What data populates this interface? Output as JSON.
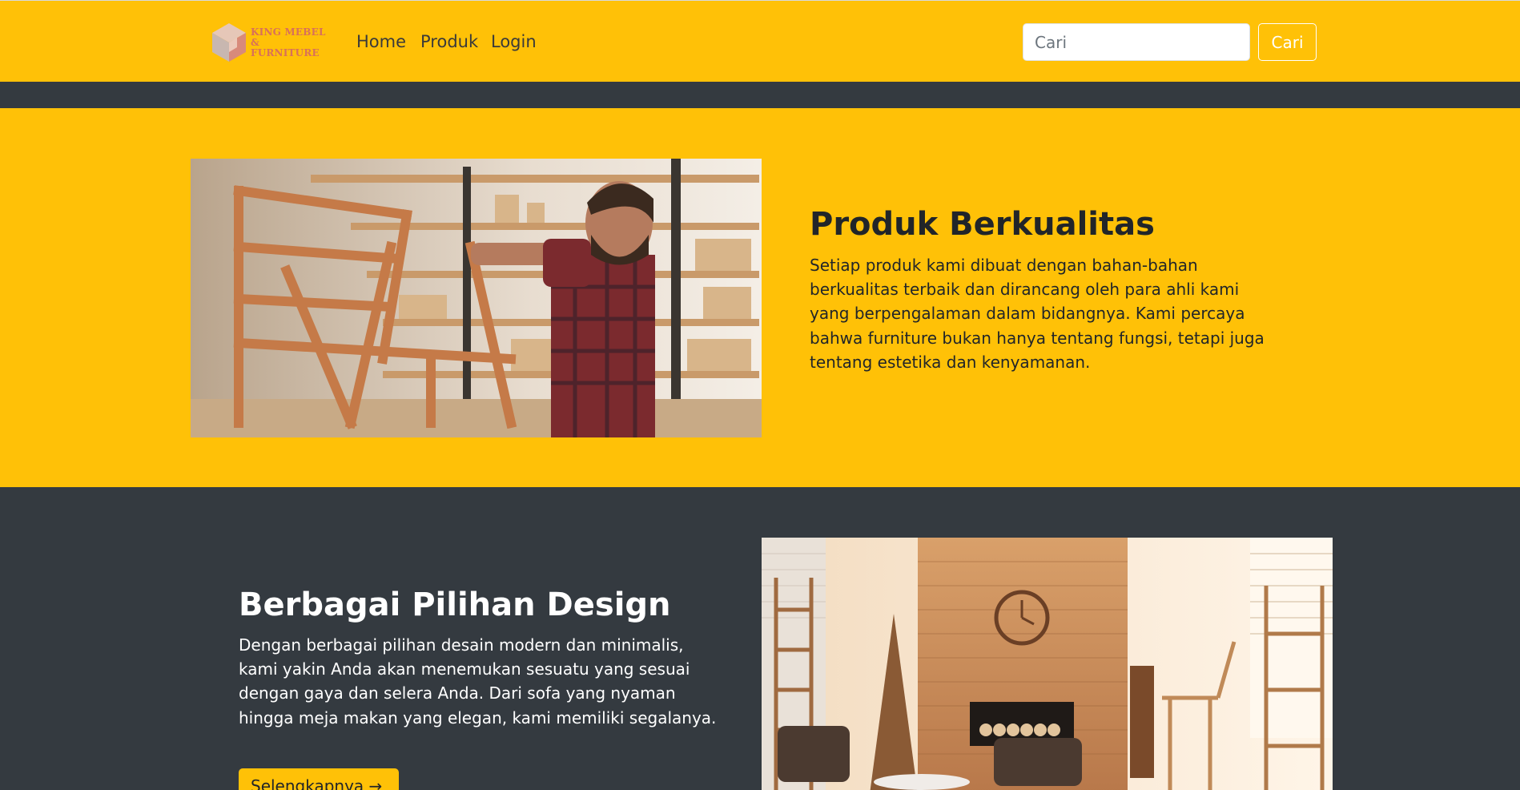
{
  "header": {
    "logo_text_line1": "KING MEBEL",
    "logo_text_line2": "& FURNITURE",
    "nav": [
      "Home",
      "Produk",
      "Login"
    ],
    "search": {
      "placeholder": "Cari",
      "value": ""
    },
    "search_button_label": "Cari"
  },
  "sections": [
    {
      "title": "Produk Berkualitas",
      "text": "Setiap produk kami dibuat dengan bahan-bahan berkualitas terbaik dan dirancang oleh para ahli kami yang berpengalaman dalam bidangnya. Kami percaya bahwa furniture bukan hanya tentang fungsi, tetapi juga tentang estetika dan kenyamanan.",
      "image": "carpenter-workshop-photo"
    },
    {
      "title": "Berbagai Pilihan Design",
      "text": "Dengan berbagai pilihan desain modern dan minimalis, kami yakin Anda akan menemukan sesuatu yang sesuai dengan gaya dan selera Anda. Dari sofa yang nyaman hingga meja makan yang elegan, kami memiliki segalanya.",
      "button_label": "Selengkapnya →",
      "image": "wooden-living-room-photo"
    }
  ],
  "colors": {
    "primary_yellow": "#ffc107",
    "dark_bg": "#343a40",
    "logo_accent": "#d8705a"
  }
}
